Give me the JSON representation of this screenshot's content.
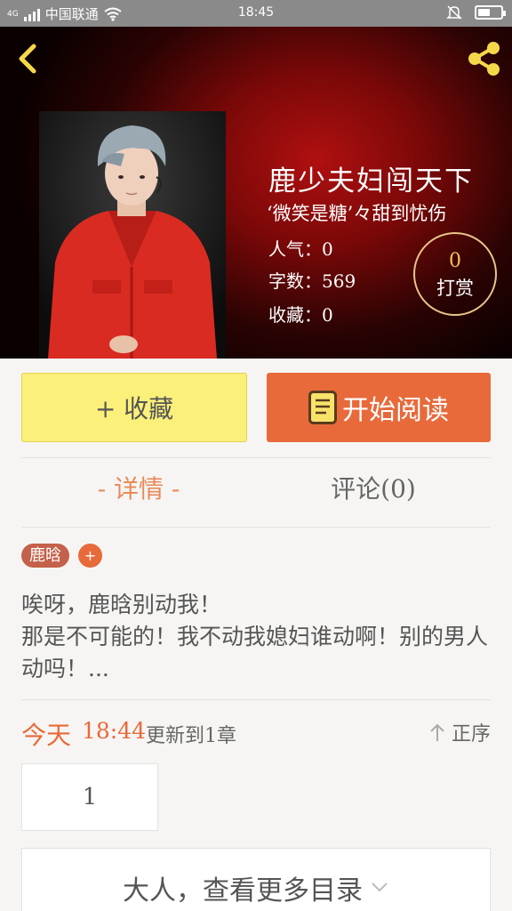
{
  "status_bar": {
    "carrier": "中国联通",
    "network": "4G",
    "time": "18:45",
    "battery_level": 0.55
  },
  "book": {
    "title": "鹿少夫妇闯天下",
    "author": "‘微笑是糖’々甜到忧伤",
    "stats": {
      "popularity": "人气：0",
      "word_count": "字数：569",
      "favorites": "收藏：0"
    },
    "reward": {
      "count": "0",
      "label": "打赏"
    }
  },
  "actions": {
    "favorite_label": "+ 收藏",
    "read_label": "开始阅读"
  },
  "tabs": {
    "details": "- 详情 -",
    "comments": "评论(0)"
  },
  "tags": [
    "鹿晗"
  ],
  "tag_add": "+",
  "description": {
    "line1": "唉呀，鹿晗别动我！",
    "line2": "那是不可能的！我不动我媳妇谁动啊！别的男人动吗！..."
  },
  "update": {
    "day": "今天",
    "time": "18:44",
    "text": "更新到1章",
    "sort_label": "正序"
  },
  "chapters": [
    "1"
  ],
  "more_toc": "大人，查看更多目录",
  "colors": {
    "accent": "#e86a3a",
    "fav_button": "#fbf07a",
    "tag": "#c4614a",
    "reward_border": "#e8c58a",
    "back_arrow": "#f5d84a"
  },
  "icons": {
    "back": "back-arrow-icon",
    "share": "share-icon",
    "read": "book-icon",
    "sort": "up-arrow-icon",
    "more": "chevron-down-icon"
  }
}
